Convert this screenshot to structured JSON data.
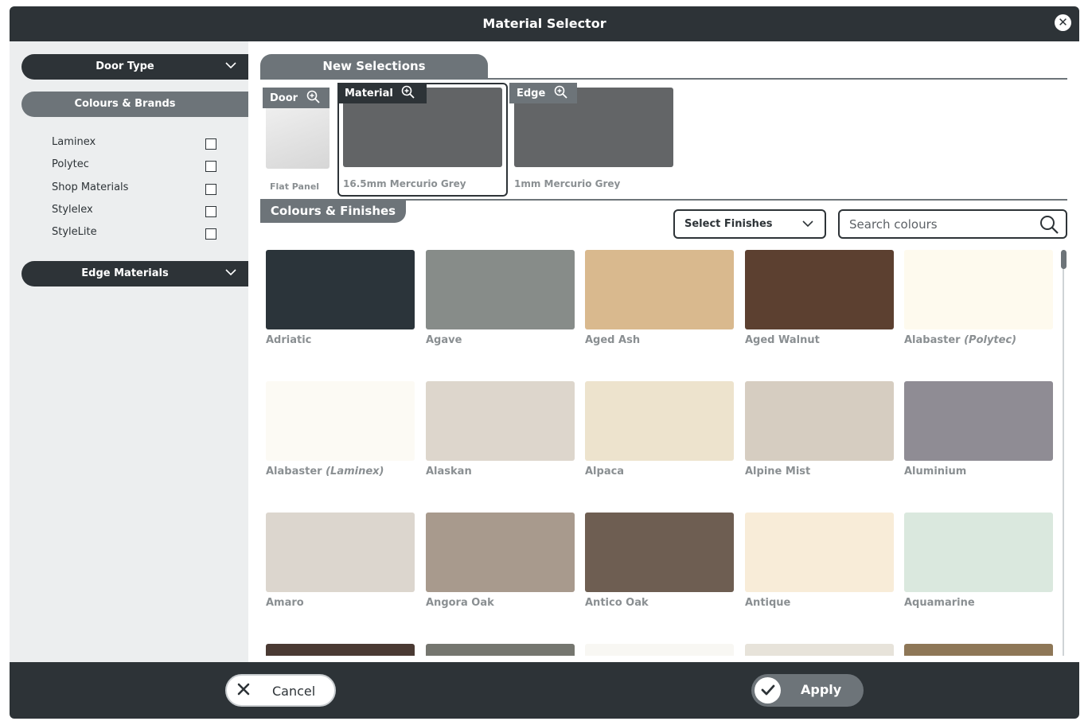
{
  "window": {
    "title": "Material Selector",
    "close_icon": "close-icon"
  },
  "sidebar": {
    "door_type": {
      "label": "Door Type"
    },
    "colours_brands": {
      "label": "Colours & Brands",
      "brands": [
        {
          "label": "Laminex",
          "checked": false
        },
        {
          "label": "Polytec",
          "checked": false
        },
        {
          "label": "Shop Materials",
          "checked": false
        },
        {
          "label": "Stylelex",
          "checked": false
        },
        {
          "label": "StyleLite",
          "checked": false
        }
      ]
    },
    "edge_materials": {
      "label": "Edge Materials"
    }
  },
  "selections": {
    "header": "New Selections",
    "door": {
      "tag": "Door",
      "caption": "Flat Panel"
    },
    "material": {
      "tag": "Material",
      "caption": "16.5mm Mercurio Grey",
      "color": "#626466"
    },
    "edge": {
      "tag": "Edge",
      "caption": "1mm Mercurio Grey",
      "color": "#636567"
    }
  },
  "finishes": {
    "header": "Colours & Finishes",
    "select_label": "Select Finishes",
    "search_placeholder": "Search colours",
    "tiles": [
      {
        "name": "Adriatic",
        "note": "",
        "color": "#2b343a"
      },
      {
        "name": "Agave",
        "note": "",
        "color": "#878c89"
      },
      {
        "name": "Aged Ash",
        "note": "",
        "color": "#d9b98e"
      },
      {
        "name": "Aged Walnut",
        "note": "",
        "color": "#5c4030"
      },
      {
        "name": "Alabaster",
        "note": "(Polytec)",
        "color": "#fefaee"
      },
      {
        "name": "Alabaster",
        "note": "(Laminex)",
        "color": "#fcfaf4"
      },
      {
        "name": "Alaskan",
        "note": "",
        "color": "#ddd6cc"
      },
      {
        "name": "Alpaca",
        "note": "",
        "color": "#ede3cd"
      },
      {
        "name": "Alpine Mist",
        "note": "",
        "color": "#d6cdc1"
      },
      {
        "name": "Aluminium",
        "note": "",
        "color": "#8f8c94"
      },
      {
        "name": "Amaro",
        "note": "",
        "color": "#dcd6ce"
      },
      {
        "name": "Angora Oak",
        "note": "",
        "color": "#a89a8d"
      },
      {
        "name": "Antico Oak",
        "note": "",
        "color": "#6e5e52"
      },
      {
        "name": "Antique",
        "note": "",
        "color": "#f8ecd8"
      },
      {
        "name": "Aquamarine",
        "note": "",
        "color": "#dae8de"
      },
      {
        "name": "",
        "note": "",
        "color": "#4a3a33"
      },
      {
        "name": "",
        "note": "",
        "color": "#75766f"
      },
      {
        "name": "",
        "note": "",
        "color": "#f8f7f3"
      },
      {
        "name": "",
        "note": "",
        "color": "#e7e3da"
      },
      {
        "name": "",
        "note": "",
        "color": "#8e7757"
      }
    ]
  },
  "footer": {
    "cancel_label": "Cancel",
    "apply_label": "Apply"
  }
}
